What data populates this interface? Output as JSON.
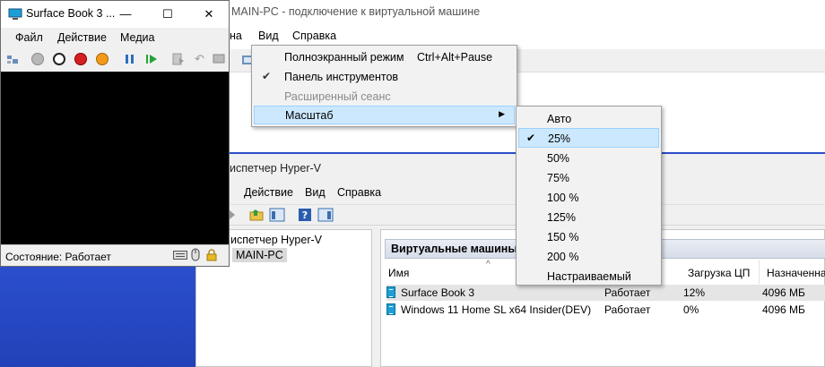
{
  "vm_window": {
    "title": "Surface Book 3 ...",
    "minimize": "—",
    "maximize": "☐",
    "close": "✕",
    "menu": [
      "Файл",
      "Действие",
      "Медиа"
    ],
    "status": "Состояние: Работает"
  },
  "connection_window": {
    "title": "MAIN-PC - подключение к виртуальной машине",
    "menu_partial": "на",
    "menu_view": "Вид",
    "menu_help": "Справка"
  },
  "view_menu": {
    "items": [
      {
        "label": "Полноэкранный режим",
        "shortcut": "Ctrl+Alt+Pause",
        "checked": "",
        "state": "enabled"
      },
      {
        "label": "Панель инструментов",
        "shortcut": "",
        "checked": "✔",
        "state": "enabled"
      },
      {
        "label": "Расширенный сеанс",
        "shortcut": "",
        "checked": "",
        "state": "disabled"
      },
      {
        "label": "Масштаб",
        "shortcut": "",
        "checked": "",
        "state": "highlighted",
        "submenu_arrow": "▶"
      }
    ]
  },
  "zoom_submenu": {
    "items": [
      {
        "label": "Авто",
        "checked": ""
      },
      {
        "label": "25%",
        "checked": "✔"
      },
      {
        "label": "50%",
        "checked": ""
      },
      {
        "label": "75%",
        "checked": ""
      },
      {
        "label": "100 %",
        "checked": ""
      },
      {
        "label": "125%",
        "checked": ""
      },
      {
        "label": "150 %",
        "checked": ""
      },
      {
        "label": "200 %",
        "checked": ""
      },
      {
        "label": "Настраиваемый",
        "checked": ""
      }
    ]
  },
  "hyperv_manager": {
    "title": "испетчер Hyper-V",
    "menu": [
      "Действие",
      "Вид",
      "Справка"
    ],
    "tree_root": "испетчер Hyper-V",
    "tree_host": "MAIN-PC",
    "panel_title": "Виртуальные машины",
    "sort_glyph": "^",
    "columns": [
      "Имя",
      "Загрузка ЦП",
      "Назначенная"
    ],
    "rows": [
      {
        "name": "Surface Book 3",
        "state": "Работает",
        "cpu": "12%",
        "memory": "4096 МБ"
      },
      {
        "name": "Windows 11 Home SL x64 Insider(DEV)",
        "state": "Работает",
        "cpu": "0%",
        "memory": "4096 МБ"
      }
    ]
  }
}
